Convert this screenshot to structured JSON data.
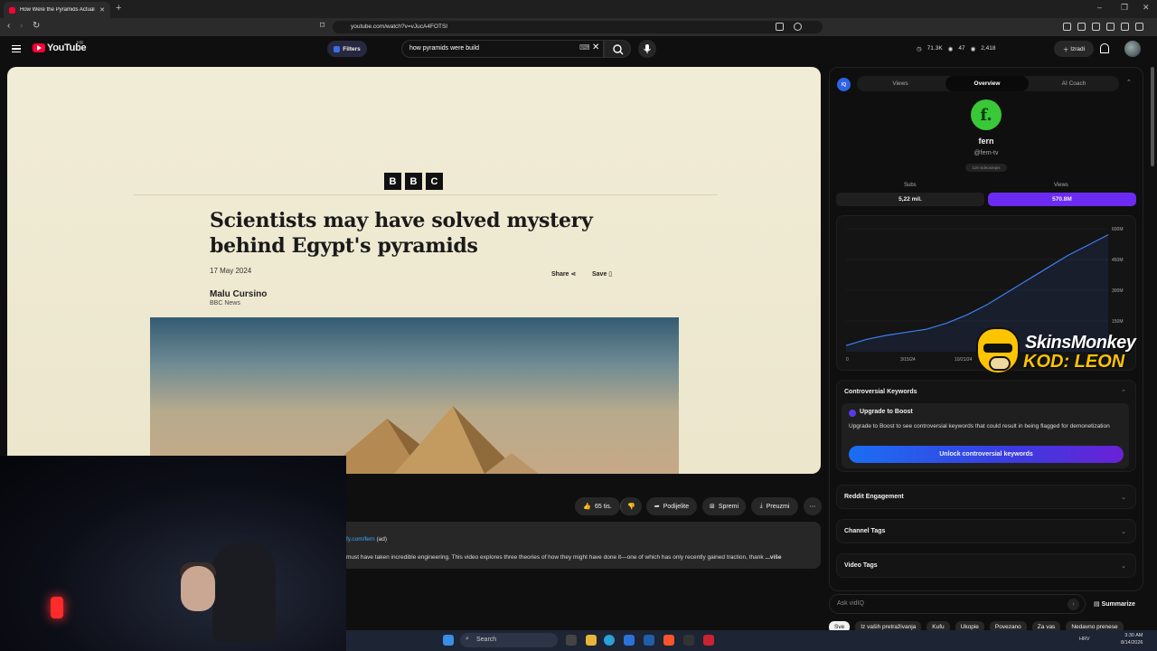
{
  "browser": {
    "tab_title": "How Were the Pyramids Actuall...",
    "url": "youtube.com/watch?v=vJucA4FOTSI"
  },
  "header": {
    "brand": "YouTube",
    "country": "HR",
    "filters_label": "Filters",
    "search_value": "how pyramids were build",
    "stats": [
      "71.3K",
      "47",
      "2,418"
    ],
    "create_label": "Izradi"
  },
  "video": {
    "bbc_letters": [
      "B",
      "B",
      "C"
    ],
    "headline": "Scientists may have solved mystery behind Egypt's pyramids",
    "date": "17 May 2024",
    "share_label": "Share",
    "save_label": "Save",
    "author": "Malu Cursino",
    "outlet": "BBC News"
  },
  "actions": {
    "likes": "65 tis.",
    "share": "Podijelite",
    "save": "Spremi",
    "download": "Preuzmi"
  },
  "description": {
    "link": "fy.com/fern",
    "link_suffix": "(ad)",
    "text": "must have taken incredible engineering. This video explores three theories of how they might have done it—one of which has only recently gained traction, thank",
    "more": "...više"
  },
  "sidebar": {
    "tabs": [
      "Views",
      "Overview",
      "AI Coach"
    ],
    "channel_logo": "f.",
    "channel_name": "fern",
    "channel_handle": "@fern-tv",
    "channel_pill": "115 videos/epis",
    "subs_label": "Subs",
    "subs_value": "5,22 mil.",
    "views_label": "Views",
    "views_value": "570.8M",
    "controversial_title": "Controversial Keywords",
    "boost_title": "Upgrade to Boost",
    "boost_text": "Upgrade to Boost to see controversial keywords that could result in being flagged for demonetization",
    "unlock_label": "Unlock controversial keywords",
    "reddit_title": "Reddit Engagement",
    "channel_tags_title": "Channel Tags",
    "video_tags_title": "Video Tags",
    "ask_placeholder": "Ask vidIQ",
    "summarize_label": "Summarize"
  },
  "chart_data": {
    "type": "line",
    "x": [
      "3/15/24",
      "10/21/24"
    ],
    "x_ticks": [
      "0",
      "3/15/24",
      "10/21/24"
    ],
    "y_ticks": [
      "600M",
      "450M",
      "300M",
      "150M"
    ],
    "values": [
      30,
      60,
      80,
      95,
      110,
      140,
      180,
      230,
      290,
      350,
      410,
      470,
      520,
      570.8
    ],
    "ylim": [
      0,
      600
    ],
    "grid": true
  },
  "watermark": {
    "line1": "SkinsMonkey",
    "line2": "KOD: LEON"
  },
  "chips": [
    "Sve",
    "Iz vaših pretraživanja",
    "Kufu",
    "Ukopie",
    "Povezano",
    "Za vas",
    "Nedavno prenese"
  ],
  "taskbar": {
    "search_label": "Search",
    "lang": "HRV",
    "time": "3:30 AM",
    "date": "8/14/2026"
  },
  "colors": {
    "accent": "#6c2bf2",
    "unlock_start": "#1b6ef3",
    "unlock_end": "#6a21d6",
    "yt_red": "#ff0033"
  }
}
